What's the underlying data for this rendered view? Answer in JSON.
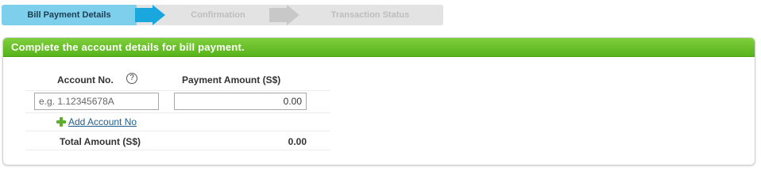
{
  "steps": [
    {
      "label": "Bill Payment Details",
      "state": "active"
    },
    {
      "label": "Confirmation",
      "state": "inactive"
    },
    {
      "label": "Transaction Status",
      "state": "inactive"
    }
  ],
  "colors": {
    "active_step": "#7ecfec",
    "active_arrow": "#1aa7dd",
    "inactive_arrow": "#c8c8c8",
    "panel_header": "#65be24"
  },
  "panel": {
    "title": "Complete the account details for bill payment.",
    "account_header": "Account No.",
    "help_icon_glyph": "?",
    "amount_header": "Payment Amount (S$)",
    "account_placeholder": "e.g. 1.12345678A",
    "amount_value": "0.00",
    "add_account_label": "Add Account No",
    "total_label": "Total Amount (S$)",
    "total_value": "0.00"
  }
}
